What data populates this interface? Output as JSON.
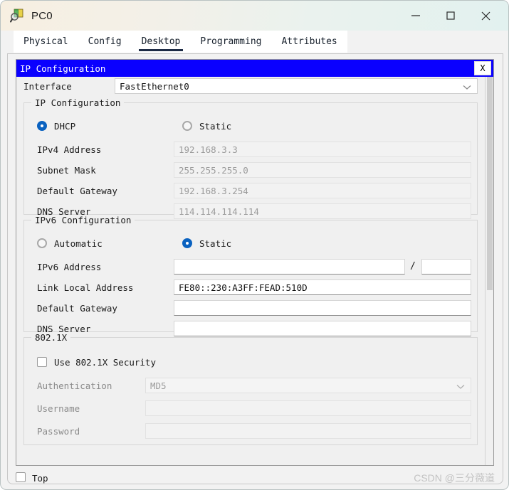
{
  "window": {
    "title": "PC0",
    "icon": "packet-tracer-device-icon",
    "controls": {
      "minimize": "minimize-icon",
      "maximize": "maximize-icon",
      "close": "close-icon"
    }
  },
  "tabs": [
    {
      "label": "Physical",
      "active": false
    },
    {
      "label": "Config",
      "active": false
    },
    {
      "label": "Desktop",
      "active": true
    },
    {
      "label": "Programming",
      "active": false
    },
    {
      "label": "Attributes",
      "active": false
    }
  ],
  "dialog": {
    "title": "IP Configuration",
    "close_label": "X",
    "header_color": "#0a00ff"
  },
  "interface": {
    "label": "Interface",
    "value": "FastEthernet0",
    "chevron": "chevron-down-icon"
  },
  "ipv4": {
    "group_title": "IP Configuration",
    "modes": [
      {
        "label": "DHCP",
        "selected": true
      },
      {
        "label": "Static",
        "selected": false
      }
    ],
    "fields": [
      {
        "label": "IPv4 Address",
        "value": "192.168.3.3",
        "disabled": true
      },
      {
        "label": "Subnet Mask",
        "value": "255.255.255.0",
        "disabled": true
      },
      {
        "label": "Default Gateway",
        "value": "192.168.3.254",
        "disabled": true
      },
      {
        "label": "DNS Server",
        "value": "114.114.114.114",
        "disabled": true
      }
    ]
  },
  "ipv6": {
    "group_title": "IPv6 Configuration",
    "modes": [
      {
        "label": "Automatic",
        "selected": false
      },
      {
        "label": "Static",
        "selected": true
      }
    ],
    "address": {
      "label": "IPv6 Address",
      "value": "",
      "separator": "/",
      "prefix_value": ""
    },
    "fields": [
      {
        "label": "Link Local Address",
        "value": "FE80::230:A3FF:FEAD:510D",
        "disabled": false
      },
      {
        "label": "Default Gateway",
        "value": "",
        "disabled": false
      },
      {
        "label": "DNS Server",
        "value": "",
        "disabled": false
      }
    ]
  },
  "dot1x": {
    "group_title": "802.1X",
    "checkbox": {
      "label": "Use 802.1X Security",
      "checked": false
    },
    "authentication": {
      "label": "Authentication",
      "value": "MD5",
      "chevron": "chevron-down-icon"
    },
    "fields": [
      {
        "label": "Username",
        "value": ""
      },
      {
        "label": "Password",
        "value": ""
      }
    ]
  },
  "footer": {
    "top_checkbox": {
      "label": "Top",
      "checked": false
    },
    "watermark": "CSDN @三分薇道"
  }
}
